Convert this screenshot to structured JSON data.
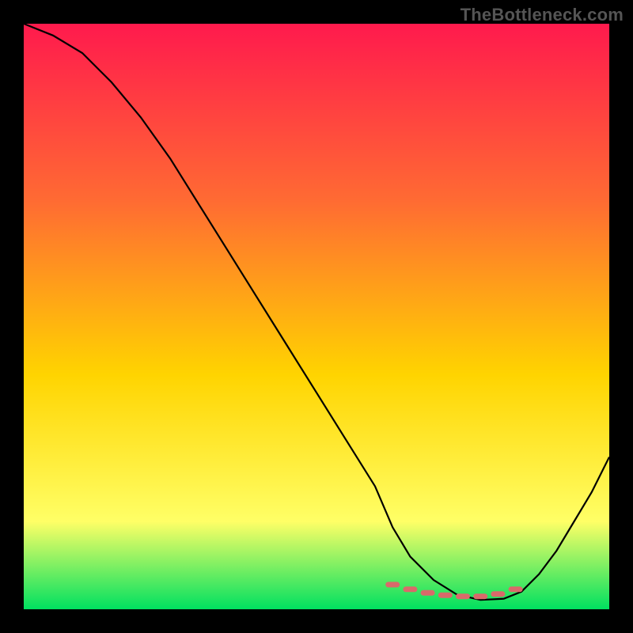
{
  "watermark": "TheBottleneck.com",
  "chart_data": {
    "type": "line",
    "title": "",
    "xlabel": "",
    "ylabel": "",
    "xlim": [
      0,
      100
    ],
    "ylim": [
      0,
      100
    ],
    "grid": false,
    "legend": false,
    "background_gradient": {
      "top": "#ff1a4d",
      "mid1": "#ff6a33",
      "mid2": "#ffd400",
      "mid3": "#ffff66",
      "bottom": "#00e060"
    },
    "series": [
      {
        "name": "curve",
        "color": "#000000",
        "x": [
          0,
          5,
          10,
          15,
          20,
          25,
          30,
          35,
          40,
          45,
          50,
          55,
          60,
          63,
          66,
          70,
          74,
          78,
          82,
          85,
          88,
          91,
          94,
          97,
          100
        ],
        "values": [
          100,
          98,
          95,
          90,
          84,
          77,
          69,
          61,
          53,
          45,
          37,
          29,
          21,
          14,
          9,
          5,
          2.5,
          1.6,
          1.8,
          3,
          6,
          10,
          15,
          20,
          26
        ]
      },
      {
        "name": "bottom-band",
        "color": "#d96a6a",
        "style": "dots",
        "x": [
          63,
          66,
          69,
          72,
          75,
          78,
          81,
          84
        ],
        "values": [
          4.2,
          3.4,
          2.8,
          2.4,
          2.2,
          2.2,
          2.6,
          3.4
        ]
      }
    ]
  }
}
